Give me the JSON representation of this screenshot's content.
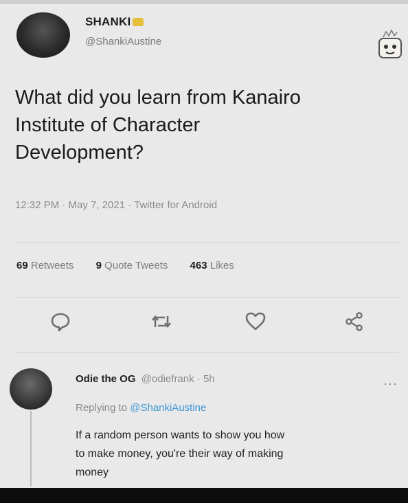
{
  "author": {
    "display_name": "SHANKI",
    "handle": "@ShankiAustine"
  },
  "tweet": {
    "text_lines": [
      "What did you learn from Kanairo",
      "Institute of Character",
      "Development?"
    ],
    "meta": "12:32 PM · May 7, 2021 · Twitter for Android"
  },
  "stats": {
    "retweets_count": "69",
    "retweets_label": "Retweets",
    "quotes_count": "9",
    "quotes_label": "Quote Tweets",
    "likes_count": "463",
    "likes_label": "Likes"
  },
  "actions": {
    "reply_icon": "speech-bubble",
    "retweet_icon": "retweet-arrows",
    "like_icon": "heart",
    "share_icon": "share-nodes",
    "icon_color": "#6f6f6f"
  },
  "reply": {
    "name": "Odie the OG",
    "handle_time": "@odiefrank · 5h",
    "replying_prefix": "Replying to",
    "replying_to": "@ShankiAustine",
    "more": "···",
    "text_lines": [
      "If a random person wants to show you how",
      "to make money, you're their way of making",
      "money"
    ]
  },
  "colors": {
    "link": "#3d95d6",
    "background": "#e9e9e9"
  }
}
